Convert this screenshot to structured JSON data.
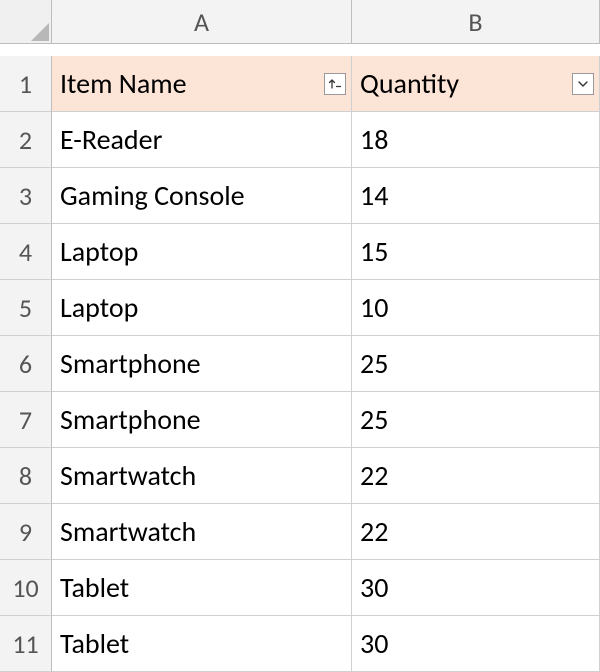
{
  "columns": [
    "A",
    "B"
  ],
  "row_numbers": [
    "1",
    "2",
    "3",
    "4",
    "5",
    "6",
    "7",
    "8",
    "9",
    "10",
    "11"
  ],
  "table": {
    "headers": {
      "A": "Item Name",
      "B": "Quantity"
    },
    "filter_states": {
      "A": "sorted-asc",
      "B": "filter"
    },
    "rows": [
      {
        "A": "E-Reader",
        "B": "18"
      },
      {
        "A": "Gaming Console",
        "B": "14"
      },
      {
        "A": "Laptop",
        "B": "15"
      },
      {
        "A": "Laptop",
        "B": "10"
      },
      {
        "A": "Smartphone",
        "B": "25"
      },
      {
        "A": "Smartphone",
        "B": "25"
      },
      {
        "A": "Smartwatch",
        "B": "22"
      },
      {
        "A": "Smartwatch",
        "B": "22"
      },
      {
        "A": "Tablet",
        "B": "30"
      },
      {
        "A": "Tablet",
        "B": "30"
      }
    ]
  }
}
